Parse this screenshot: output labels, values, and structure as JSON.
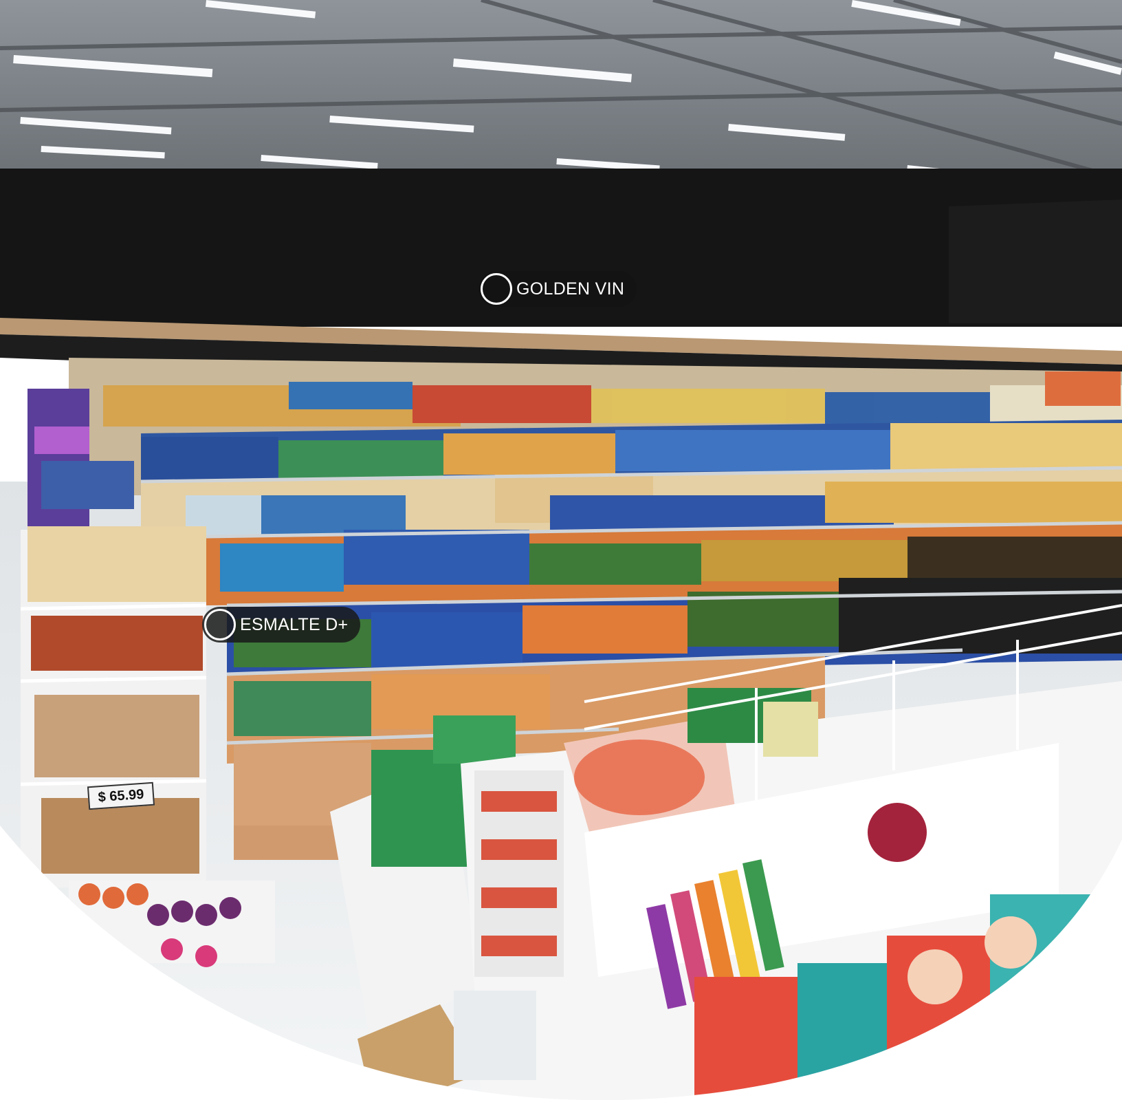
{
  "hotspots": [
    {
      "id": "golden",
      "label": "GOLDEN VIN"
    },
    {
      "id": "esmalte",
      "label": "ESMALTE D+"
    }
  ],
  "price_tag": "$ 65.99",
  "colors": {
    "ceiling": "#7a7f84",
    "wall_band": "#141414",
    "floor": "#e9ecee",
    "accent_red": "#a4233c",
    "hotspot_bg": "#1a1a1a"
  }
}
